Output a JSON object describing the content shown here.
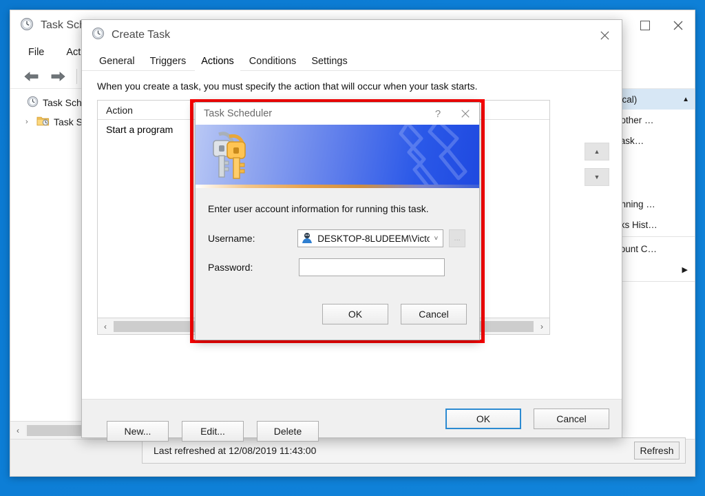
{
  "desktop": {
    "background_color": "#0b7ad1"
  },
  "main_window": {
    "title": "Task Scheduler",
    "icon": "clock-icon",
    "controls": {
      "maximize": "maximize-icon",
      "close": "close-icon"
    },
    "menu": [
      "File",
      "Action"
    ],
    "toolbar": {
      "back": "back-arrow-icon",
      "forward": "forward-arrow-icon",
      "show_pane": "show-hide-pane-icon"
    },
    "tree": [
      {
        "label": "Task Sched",
        "icon": "clock-icon",
        "level": 1,
        "caret": ""
      },
      {
        "label": "Task Sc",
        "icon": "folder-clock-icon",
        "level": 2,
        "caret": "›"
      }
    ],
    "tree_scroll": {
      "left": "‹",
      "right": "›"
    },
    "actions_pane": {
      "header": "ocal)",
      "collapse_icon": "▲",
      "items": [
        "nother …",
        "Task…",
        "",
        "unning …",
        "sks Hist…",
        "count C…"
      ],
      "submenu_arrow": "▶"
    },
    "status_bar": {
      "text": "Last refreshed at 12/08/2019 11:43:00",
      "refresh_label": "Refresh"
    }
  },
  "create_task_dialog": {
    "title": "Create Task",
    "icon": "clock-icon",
    "close_icon": "✕",
    "tabs": [
      {
        "label": "General",
        "active": false
      },
      {
        "label": "Triggers",
        "active": false
      },
      {
        "label": "Actions",
        "active": true
      },
      {
        "label": "Conditions",
        "active": false
      },
      {
        "label": "Settings",
        "active": false
      }
    ],
    "description": "When you create a task, you must specify the action that will occur when your task starts.",
    "list": {
      "columns": [
        "Action"
      ],
      "rows": [
        {
          "action": "Start a program"
        }
      ]
    },
    "move_buttons": {
      "up": "▲",
      "down": "▼"
    },
    "crud_buttons": [
      "New...",
      "Edit...",
      "Delete"
    ],
    "footer_buttons": [
      {
        "label": "OK",
        "default": true
      },
      {
        "label": "Cancel",
        "default": false
      }
    ],
    "scrollbar": {
      "left": "‹",
      "right": "›"
    }
  },
  "credential_dialog": {
    "title": "Task Scheduler",
    "help_icon": "?",
    "close_icon": "✕",
    "banner_icon": "keys-icon",
    "prompt": "Enter user account information for running this task.",
    "fields": [
      {
        "label": "Username:",
        "value": "DESKTOP-8LUDEEM\\Victo",
        "icon": "user-icon",
        "chevron": "˅",
        "browse_label": "..."
      },
      {
        "label": "Password:",
        "value": "",
        "placeholder": ""
      }
    ],
    "buttons": [
      {
        "label": "OK"
      },
      {
        "label": "Cancel"
      }
    ]
  },
  "highlight": {
    "color": "#fb0000"
  }
}
